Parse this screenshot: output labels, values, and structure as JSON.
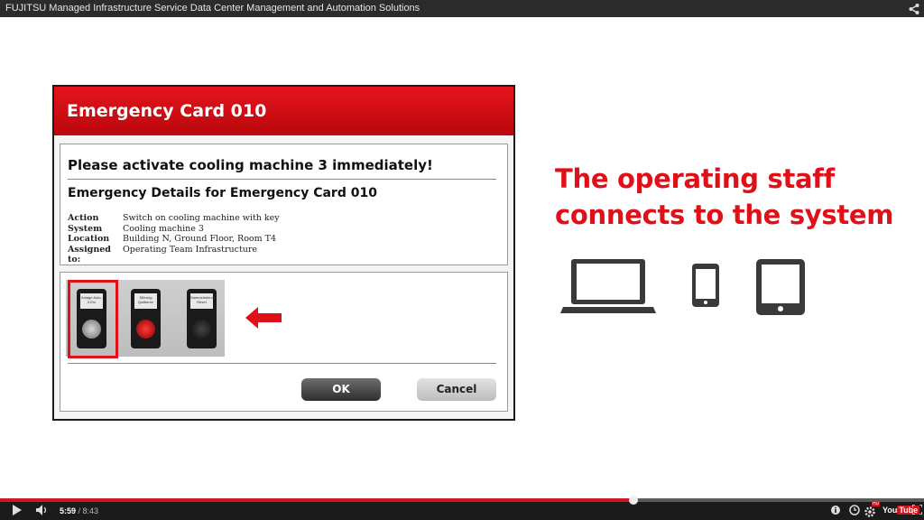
{
  "window": {
    "title": "FUJITSU Managed Infrastructure Service Data Center Management and Automation Solutions"
  },
  "dialog": {
    "title": "Emergency Card 010",
    "headline": "Please activate cooling machine 3 immediately!",
    "details_title": "Emergency Details for Emergency Card 010",
    "details": [
      {
        "label": "Action",
        "value": "Switch on cooling machine with key"
      },
      {
        "label": "System",
        "value": "Cooling machine 3"
      },
      {
        "label": "Location",
        "value": "Building N, Ground Floor, Room T4"
      },
      {
        "label": "Assigned to:",
        "value": "Operating Team Infrastructure"
      }
    ],
    "switch_labels": [
      "Anlage Auto-0-Ein",
      "Störung Quittieren",
      "Sammelstörung Reset"
    ],
    "ok_label": "OK",
    "cancel_label": "Cancel"
  },
  "tagline": {
    "line1": "The operating staff",
    "line2": "connects to the system"
  },
  "devices": [
    "laptop-icon",
    "smartphone-icon",
    "tablet-icon"
  ],
  "player": {
    "current_time": "5:59",
    "separator": " / ",
    "duration": "8:43",
    "progress_fraction": 0.686,
    "hd_badge": "HD",
    "logo_you": "You",
    "logo_tube": "Tube"
  },
  "colors": {
    "brand_red": "#e01019",
    "header_red": "#cc181e"
  }
}
